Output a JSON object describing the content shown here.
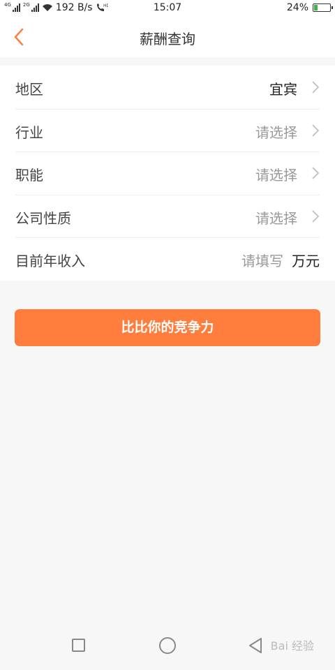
{
  "status": {
    "network_tag_1": "4G",
    "network_tag_2": "2G",
    "speed": "192 B/s",
    "time": "15:07",
    "battery": "24%",
    "battery_level": 0.24,
    "battery_color": "#3ab54a"
  },
  "header": {
    "title": "薪酬查询",
    "back_icon": "chevron-left-icon",
    "accent_color": "#ff7e3e"
  },
  "form": {
    "region": {
      "label": "地区",
      "value": "宜宾"
    },
    "industry": {
      "label": "行业",
      "value": "请选择"
    },
    "function": {
      "label": "职能",
      "value": "请选择"
    },
    "company_type": {
      "label": "公司性质",
      "value": "请选择"
    },
    "income": {
      "label": "目前年收入",
      "placeholder": "请填写",
      "unit": "万元"
    }
  },
  "action": {
    "label": "比比你的竞争力",
    "color": "#ff7e3e"
  },
  "watermark": "Bai 经验"
}
